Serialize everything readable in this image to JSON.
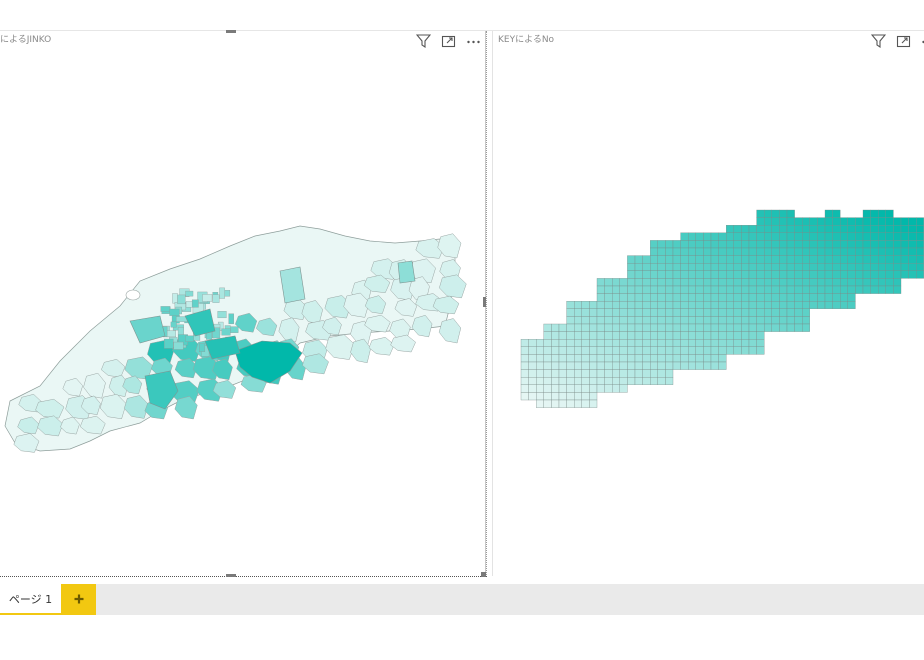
{
  "visuals": [
    {
      "title": "によるJINKO",
      "icons": [
        "filter-icon",
        "focus-mode-icon",
        "more-options-icon"
      ]
    },
    {
      "title": "KEYによるNo",
      "icons": [
        "filter-icon",
        "focus-mode-icon",
        "more-options-icon"
      ]
    }
  ],
  "tabs": [
    {
      "label": "ページ 1",
      "active": true
    }
  ],
  "add_page_icon": "plus-icon",
  "colors": {
    "map_low": "#eaf7f5",
    "map_high": "#01b8aa",
    "tab_accent": "#f2c811",
    "tab_bar": "#eaeaea"
  }
}
